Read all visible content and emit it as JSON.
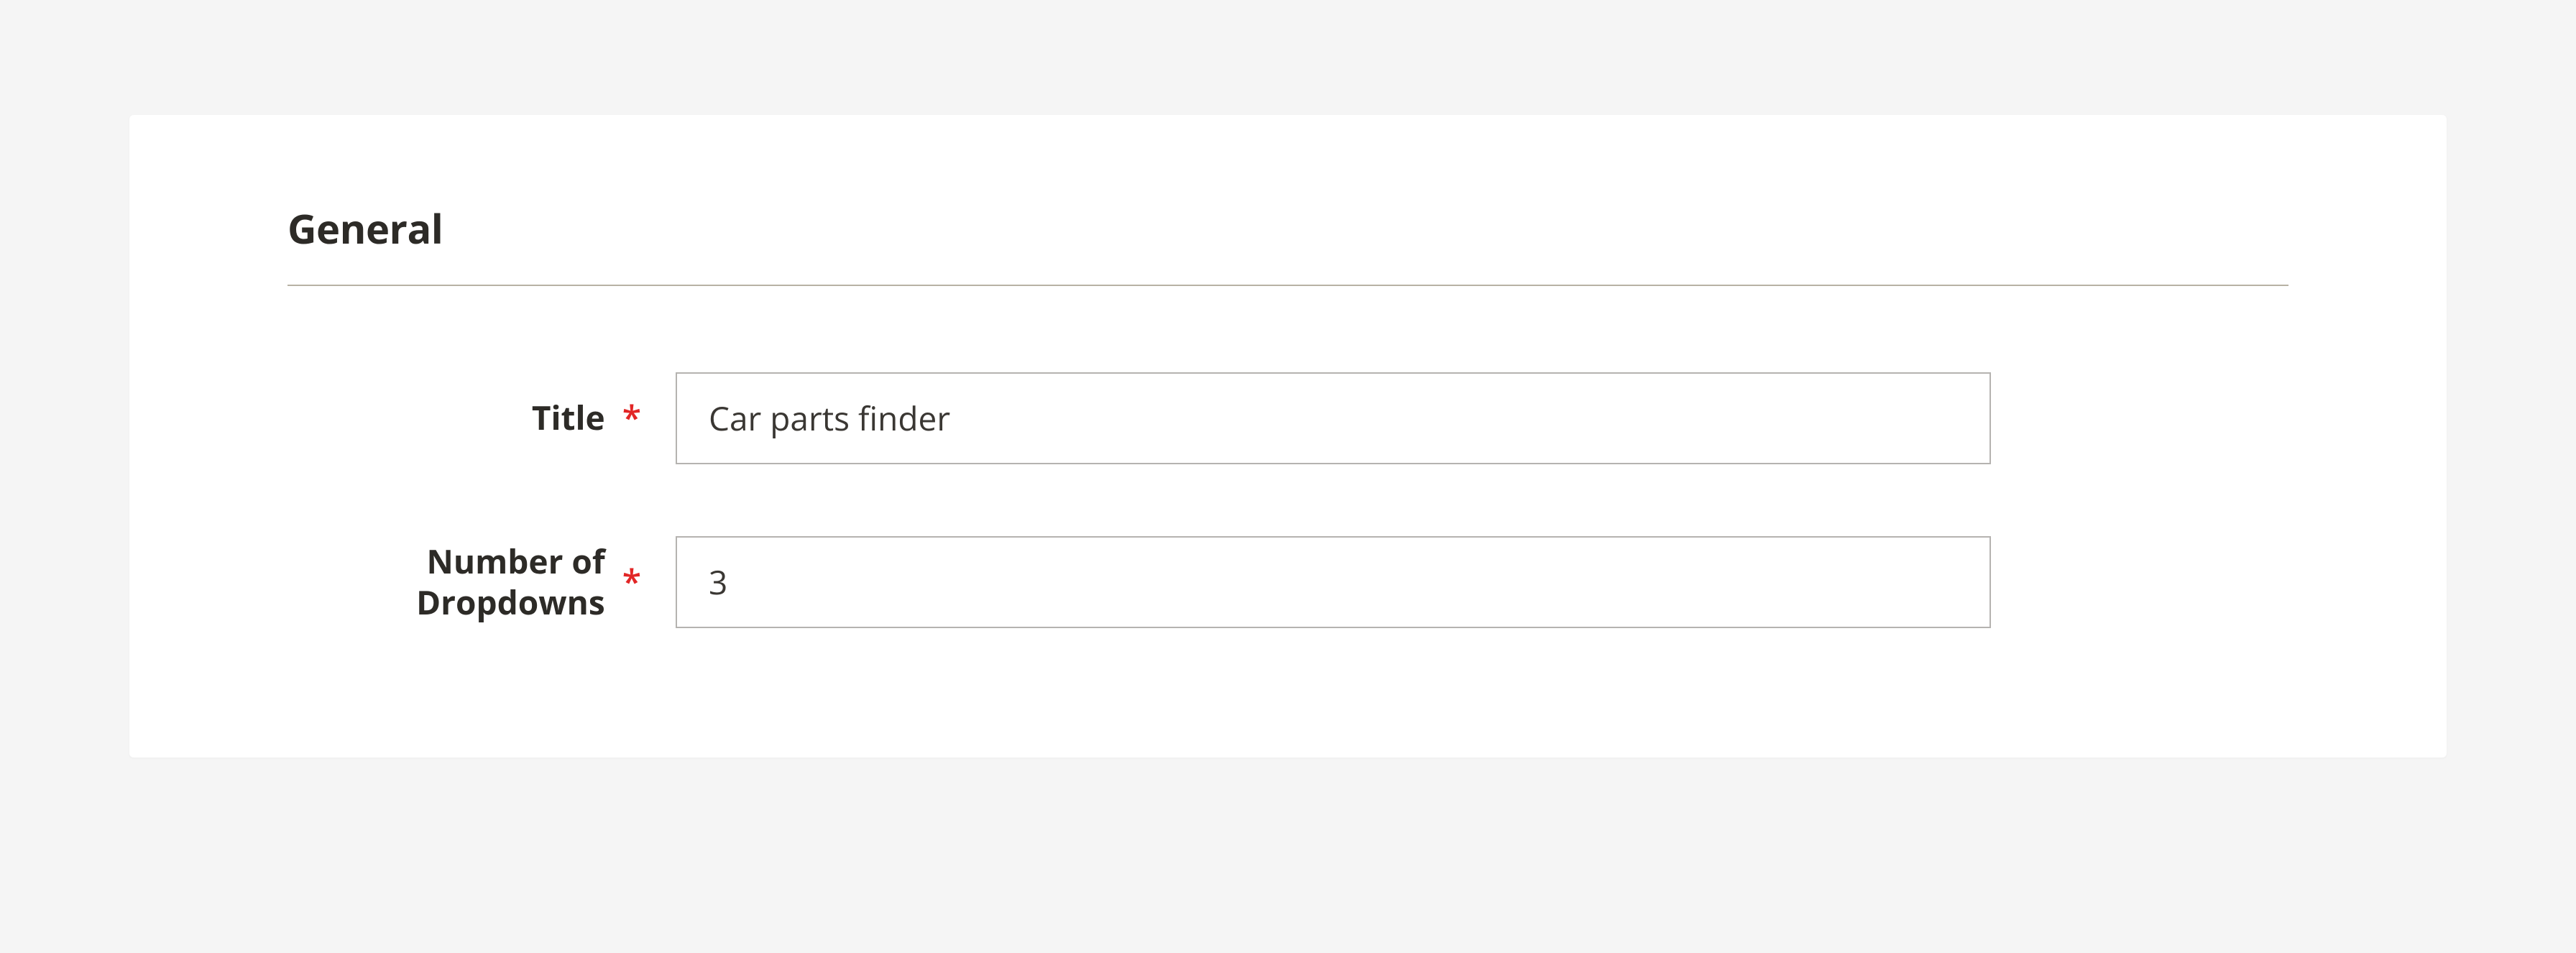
{
  "section": {
    "title": "General"
  },
  "fields": {
    "title": {
      "label": "Title",
      "value": "Car parts finder",
      "required": "*"
    },
    "dropdowns": {
      "label": "Number of Dropdowns",
      "value": "3",
      "required": "*"
    }
  }
}
